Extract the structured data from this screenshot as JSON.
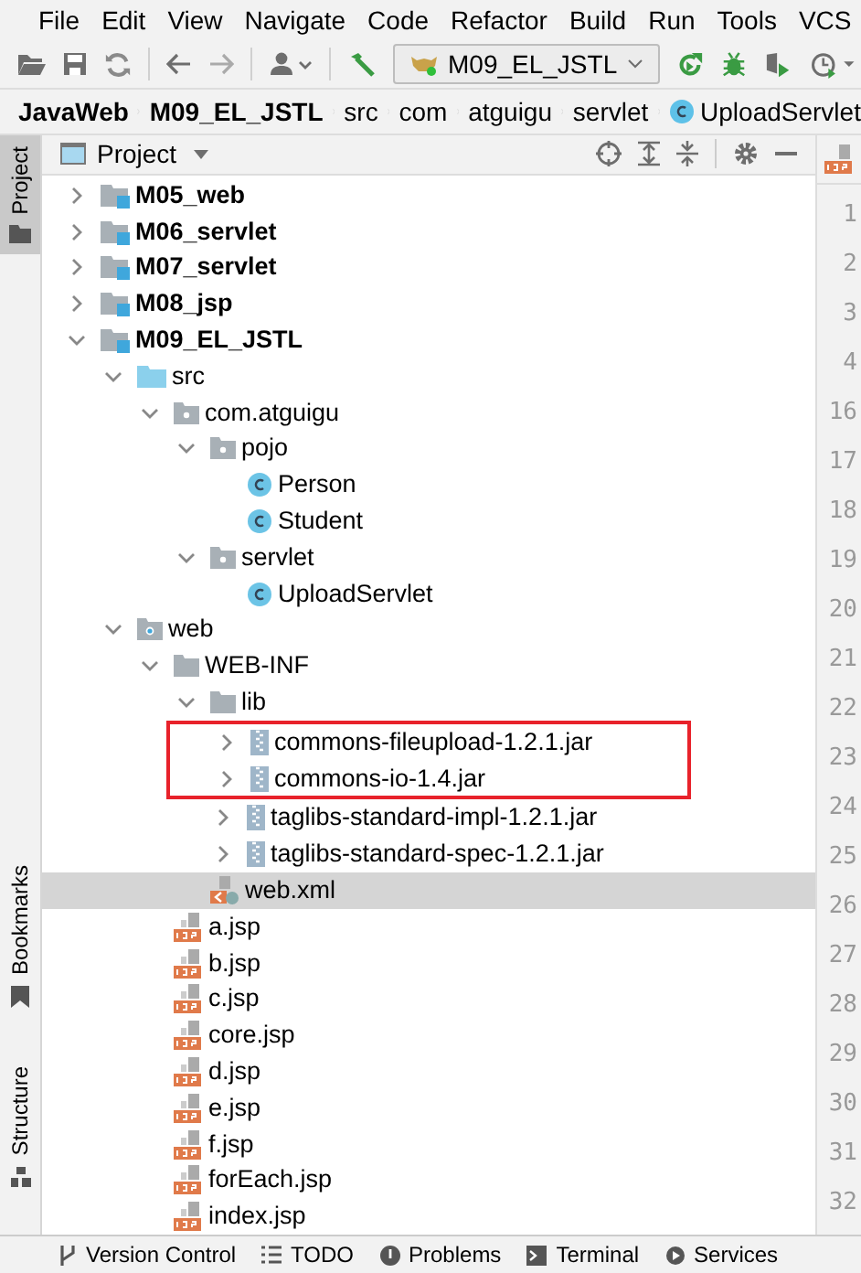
{
  "menu": [
    "File",
    "Edit",
    "View",
    "Navigate",
    "Code",
    "Refactor",
    "Build",
    "Run",
    "Tools",
    "VCS"
  ],
  "toolbar": {
    "run_config": "M09_EL_JSTL"
  },
  "breadcrumbs": [
    {
      "label": "JavaWeb",
      "kind": "project"
    },
    {
      "label": "M09_EL_JSTL",
      "kind": "module"
    },
    {
      "label": "src",
      "kind": "dir"
    },
    {
      "label": "com",
      "kind": "dir"
    },
    {
      "label": "atguigu",
      "kind": "dir"
    },
    {
      "label": "servlet",
      "kind": "dir"
    },
    {
      "label": "UploadServlet",
      "kind": "class"
    }
  ],
  "left_strip": [
    {
      "label": "Project",
      "selected": true,
      "kind": "project"
    },
    {
      "label": "Bookmarks",
      "selected": false,
      "kind": "bookmarks"
    },
    {
      "label": "Structure",
      "selected": false,
      "kind": "structure"
    }
  ],
  "project_panel": {
    "title": "Project",
    "tree": [
      {
        "label": "M05_web",
        "kind": "module",
        "expanded": false
      },
      {
        "label": "M06_servlet",
        "kind": "module",
        "expanded": false
      },
      {
        "label": "M07_servlet",
        "kind": "module",
        "expanded": false
      },
      {
        "label": "M08_jsp",
        "kind": "module",
        "expanded": false
      },
      {
        "label": "M09_EL_JSTL",
        "kind": "module",
        "expanded": true,
        "children": [
          {
            "label": "src",
            "kind": "src",
            "expanded": true,
            "children": [
              {
                "label": "com.atguigu",
                "kind": "package",
                "expanded": true,
                "children": [
                  {
                    "label": "pojo",
                    "kind": "package",
                    "expanded": true,
                    "children": [
                      {
                        "label": "Person",
                        "kind": "class"
                      },
                      {
                        "label": "Student",
                        "kind": "class"
                      }
                    ]
                  },
                  {
                    "label": "servlet",
                    "kind": "package",
                    "expanded": true,
                    "children": [
                      {
                        "label": "UploadServlet",
                        "kind": "class"
                      }
                    ]
                  }
                ]
              }
            ]
          },
          {
            "label": "web",
            "kind": "web",
            "expanded": true,
            "children": [
              {
                "label": "WEB-INF",
                "kind": "folder",
                "expanded": true,
                "children": [
                  {
                    "label": "lib",
                    "kind": "folder",
                    "expanded": true,
                    "children": [
                      {
                        "label": "commons-fileupload-1.2.1.jar",
                        "kind": "jar",
                        "expanded": false,
                        "marked": true
                      },
                      {
                        "label": "commons-io-1.4.jar",
                        "kind": "jar",
                        "expanded": false,
                        "marked": true
                      },
                      {
                        "label": "taglibs-standard-impl-1.2.1.jar",
                        "kind": "jar",
                        "expanded": false,
                        "marked": false
                      },
                      {
                        "label": "taglibs-standard-spec-1.2.1.jar",
                        "kind": "jar",
                        "expanded": false,
                        "marked": false
                      }
                    ]
                  },
                  {
                    "label": "web.xml",
                    "kind": "xml",
                    "selected": true
                  }
                ]
              },
              {
                "label": "a.jsp",
                "kind": "jsp",
                "selected": false
              },
              {
                "label": "b.jsp",
                "kind": "jsp",
                "selected": false
              },
              {
                "label": "c.jsp",
                "kind": "jsp",
                "selected": false
              },
              {
                "label": "core.jsp",
                "kind": "jsp",
                "selected": false
              },
              {
                "label": "d.jsp",
                "kind": "jsp",
                "selected": false
              },
              {
                "label": "e.jsp",
                "kind": "jsp",
                "selected": false
              },
              {
                "label": "f.jsp",
                "kind": "jsp",
                "selected": false
              },
              {
                "label": "forEach.jsp",
                "kind": "jsp",
                "selected": false
              },
              {
                "label": "index.jsp",
                "kind": "jsp",
                "selected": false
              }
            ]
          }
        ]
      }
    ]
  },
  "line_numbers": [
    "1",
    "2",
    "3",
    "4",
    "16",
    "17",
    "18",
    "19",
    "20",
    "21",
    "22",
    "23",
    "24",
    "25",
    "26",
    "27",
    "28",
    "29",
    "30",
    "31",
    "32"
  ],
  "bottom_tabs": [
    {
      "label": "Version Control",
      "kind": "vcs"
    },
    {
      "label": "TODO",
      "kind": "todo"
    },
    {
      "label": "Problems",
      "kind": "problems"
    },
    {
      "label": "Terminal",
      "kind": "terminal"
    },
    {
      "label": "Services",
      "kind": "services"
    }
  ]
}
